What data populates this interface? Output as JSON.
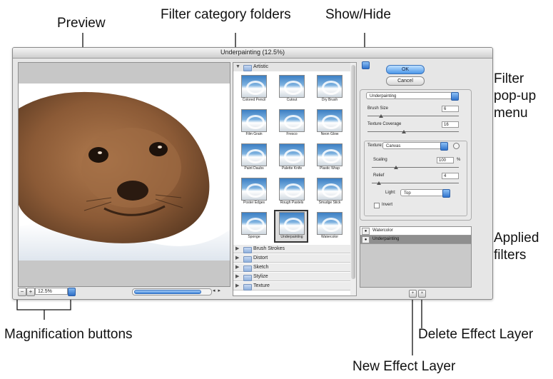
{
  "callouts": {
    "preview": "Preview",
    "filter_category_folders": "Filter category folders",
    "show_hide": "Show/Hide",
    "filter_popup_menu": "Filter\npop-up\nmenu",
    "applied_filters": "Applied\nfilters",
    "magnification_buttons": "Magnification buttons",
    "delete_effect_layer": "Delete Effect Layer",
    "new_effect_layer": "New Effect Layer"
  },
  "dialog": {
    "title": "Underpainting (12.5%)",
    "zoom": {
      "minus": "−",
      "plus": "+",
      "value": "12.5%"
    },
    "scroll_arrows": "◂ ▸"
  },
  "gallery": {
    "open_category": "Artistic",
    "filters": [
      "Colored Pencil",
      "Cutout",
      "Dry Brush",
      "Film Grain",
      "Fresco",
      "Neon Glow",
      "Paint Daubs",
      "Palette Knife",
      "Plastic Wrap",
      "Poster Edges",
      "Rough Pastels",
      "Smudge Stick",
      "Sponge",
      "Underpainting",
      "Watercolor"
    ],
    "selected_filter": "Underpainting",
    "collapsed_categories": [
      "Brush Strokes",
      "Distort",
      "Sketch",
      "Stylize",
      "Texture"
    ]
  },
  "buttons": {
    "ok": "OK",
    "cancel": "Cancel"
  },
  "settings": {
    "filter_popup": "Underpainting",
    "brush_size_label": "Brush Size",
    "brush_size": "6",
    "brush_size_level": 0.15,
    "texture_coverage_label": "Texture Coverage",
    "texture_coverage": "16",
    "texture_coverage_level": 0.4,
    "texture_label": "Texture:",
    "texture_value": "Canvas",
    "scaling_label": "Scaling",
    "scaling": "100",
    "scaling_unit": "%",
    "scaling_level": 0.28,
    "relief_label": "Relief",
    "relief": "4",
    "relief_level": 0.08,
    "light_label": "Light:",
    "light_value": "Top",
    "invert_label": "Invert"
  },
  "layers": {
    "eye_glyph": "●",
    "items": [
      "Watercolor",
      "Underpainting"
    ],
    "new_glyph": "+",
    "delete_glyph": "×"
  }
}
